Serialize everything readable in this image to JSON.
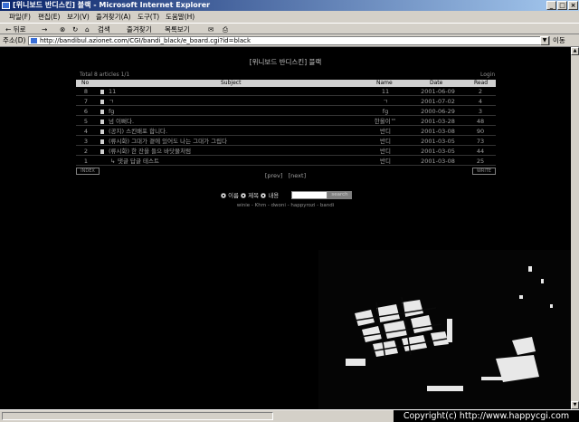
{
  "window": {
    "title": "[위니보드 반디스킨] 블랙 - Microsoft Internet Explorer",
    "controls": {
      "minimize": "_",
      "maximize": "□",
      "close": "×"
    }
  },
  "menu": [
    "파일(F)",
    "편집(E)",
    "보기(V)",
    "즐겨찾기(A)",
    "도구(T)",
    "도움말(H)"
  ],
  "toolbar": {
    "back": "← 뒤로",
    "forward": "→",
    "search": "검색",
    "favorites": "즐겨찾기",
    "history": "목록보기"
  },
  "address": {
    "label": "주소(D)",
    "url": "http://bandibul.azionet.com/CGI/bandi_black/e_board.cgi?id=black",
    "go": "이동"
  },
  "board": {
    "title": "[위니보드 반디스킨] 블랙",
    "total_label": "Total",
    "total_count": "8",
    "total_unit": "articles",
    "page": "1/1",
    "login": "Login",
    "columns": {
      "no": "No",
      "subject": "Subject",
      "name": "Name",
      "date": "Date",
      "read": "Read"
    },
    "rows": [
      {
        "no": "8",
        "subject": "11",
        "name": "11",
        "date": "2001-06-09",
        "read": "2"
      },
      {
        "no": "7",
        "subject": "ㄱ",
        "name": "ㄱ",
        "date": "2001-07-02",
        "read": "4"
      },
      {
        "no": "6",
        "subject": "fg",
        "name": "fg",
        "date": "2000-06-29",
        "read": "3"
      },
      {
        "no": "5",
        "subject": "넘 이뻐다.",
        "name": "한올이™",
        "date": "2001-03-28",
        "read": "48"
      },
      {
        "no": "4",
        "subject": "(공지) 스킨배포 합니다.",
        "name": "반디",
        "date": "2001-03-08",
        "read": "90"
      },
      {
        "no": "3",
        "subject": "(류시화) 그대가 곁에 있어도 나는 그대가 그립다",
        "name": "반디",
        "date": "2001-03-05",
        "read": "73"
      },
      {
        "no": "2",
        "subject": "(류시화) 한 잔을 들으 바닷물처럼",
        "name": "반디",
        "date": "2001-03-05",
        "read": "44"
      },
      {
        "no": "1",
        "subject": "댓글 답글 테스트",
        "name": "반디",
        "date": "2001-03-08",
        "read": "25"
      }
    ],
    "index_button": "INDEX",
    "write_button": "WRITE",
    "prev": "[prev]",
    "next": "[next]"
  },
  "search": {
    "options": [
      "이름",
      "제목",
      "내용"
    ],
    "button": "search"
  },
  "credits": "winie - Khm - dwoni - happyrozi - bandi",
  "watermark": "Copyright(c) http://www.happycgi.com"
}
